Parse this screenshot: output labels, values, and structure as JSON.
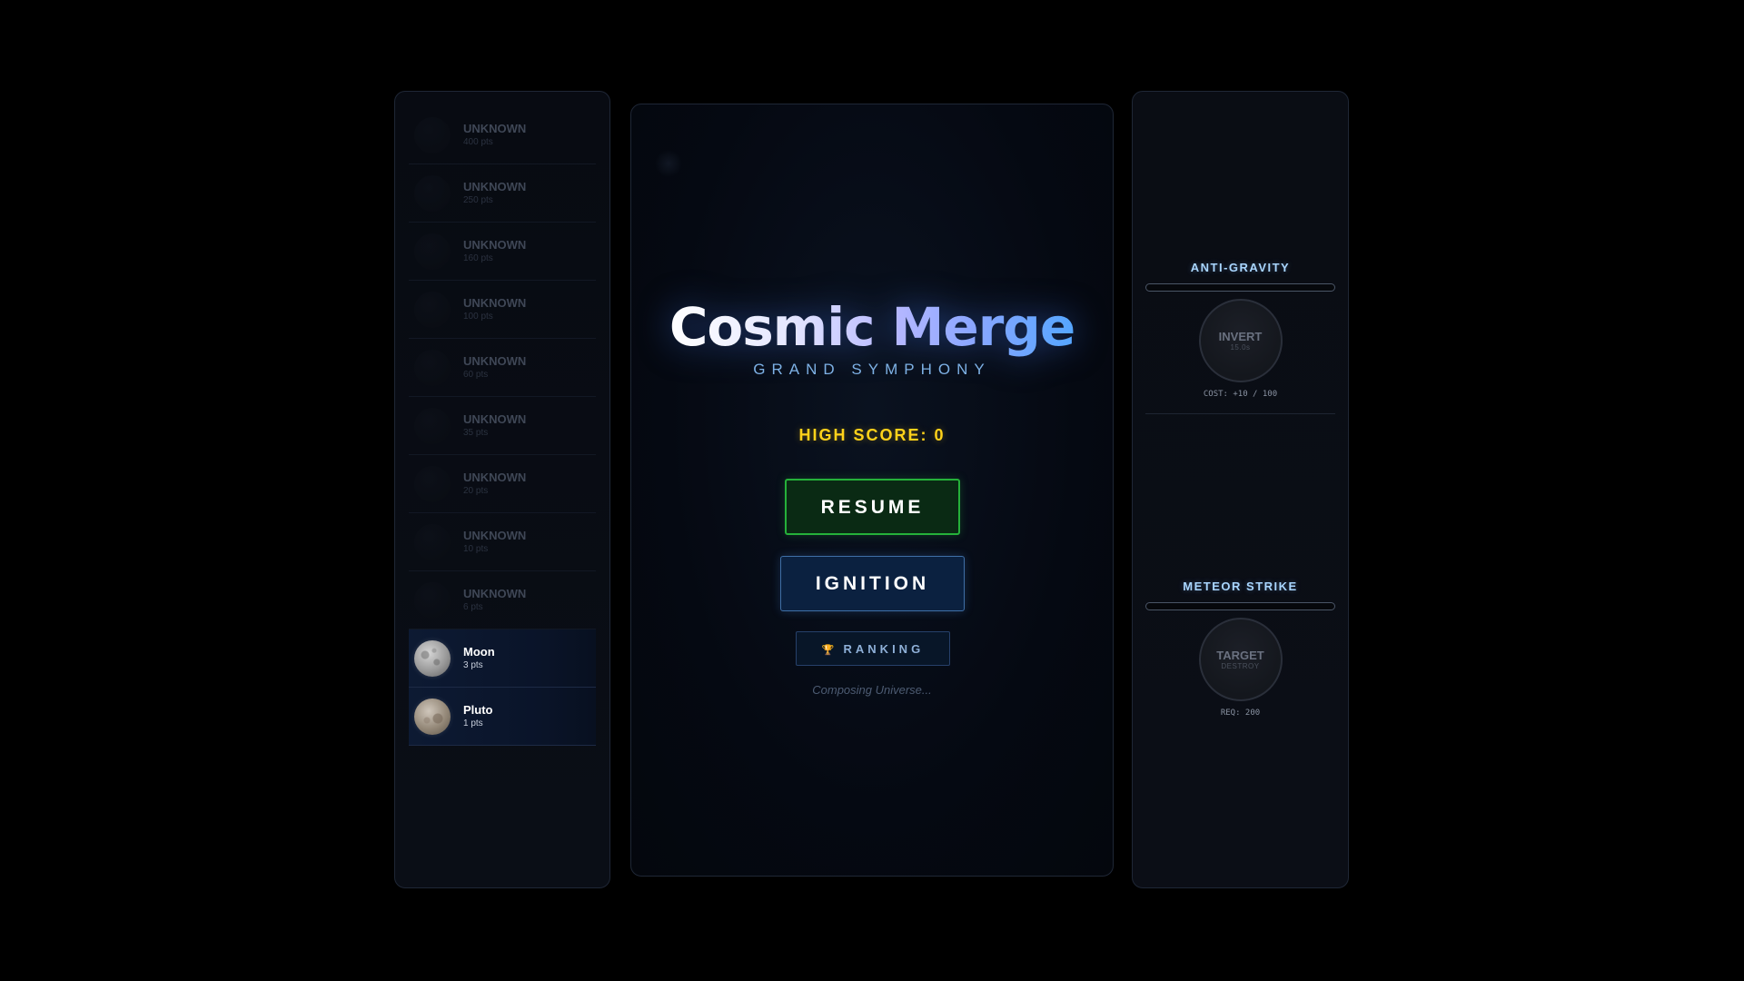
{
  "planets": {
    "items": [
      {
        "name": "UNKNOWN",
        "pts": "400 pts",
        "state": "locked"
      },
      {
        "name": "UNKNOWN",
        "pts": "250 pts",
        "state": "locked"
      },
      {
        "name": "UNKNOWN",
        "pts": "160 pts",
        "state": "locked"
      },
      {
        "name": "UNKNOWN",
        "pts": "100 pts",
        "state": "locked"
      },
      {
        "name": "UNKNOWN",
        "pts": "60 pts",
        "state": "locked"
      },
      {
        "name": "UNKNOWN",
        "pts": "35 pts",
        "state": "locked"
      },
      {
        "name": "UNKNOWN",
        "pts": "20 pts",
        "state": "locked"
      },
      {
        "name": "UNKNOWN",
        "pts": "10 pts",
        "state": "locked"
      },
      {
        "name": "UNKNOWN",
        "pts": "6 pts",
        "state": "locked"
      },
      {
        "name": "Moon",
        "pts": "3 pts",
        "state": "unlocked",
        "icon": "moon-planet-icon"
      },
      {
        "name": "Pluto",
        "pts": "1 pts",
        "state": "unlocked",
        "icon": "pluto-planet-icon"
      }
    ]
  },
  "menu": {
    "title": "Cosmic Merge",
    "subtitle": "GRAND SYMPHONY",
    "high_score": "HIGH SCORE: 0",
    "resume_label": "RESUME",
    "ignition_label": "IGNITION",
    "ranking_icon": "trophy-icon",
    "ranking_label": "RANKING",
    "status": "Composing Universe..."
  },
  "abilities": [
    {
      "title": "ANTI-GRAVITY",
      "button_label": "INVERT",
      "button_sub": "15.0s",
      "cost": "COST: +10 / 100",
      "charge": 0
    },
    {
      "title": "METEOR STRIKE",
      "button_label": "TARGET",
      "button_sub": "DESTROY",
      "cost": "REQ: 200",
      "charge": 0
    }
  ],
  "colors": {
    "background": "#000000",
    "panel_border": "#1f2736",
    "resume_border": "#25b13a",
    "ignition_border": "#3f6fa6",
    "high_score": "#ffd21a",
    "subtitle": "#7fb3e6",
    "ability_title": "#a9d6ff"
  }
}
